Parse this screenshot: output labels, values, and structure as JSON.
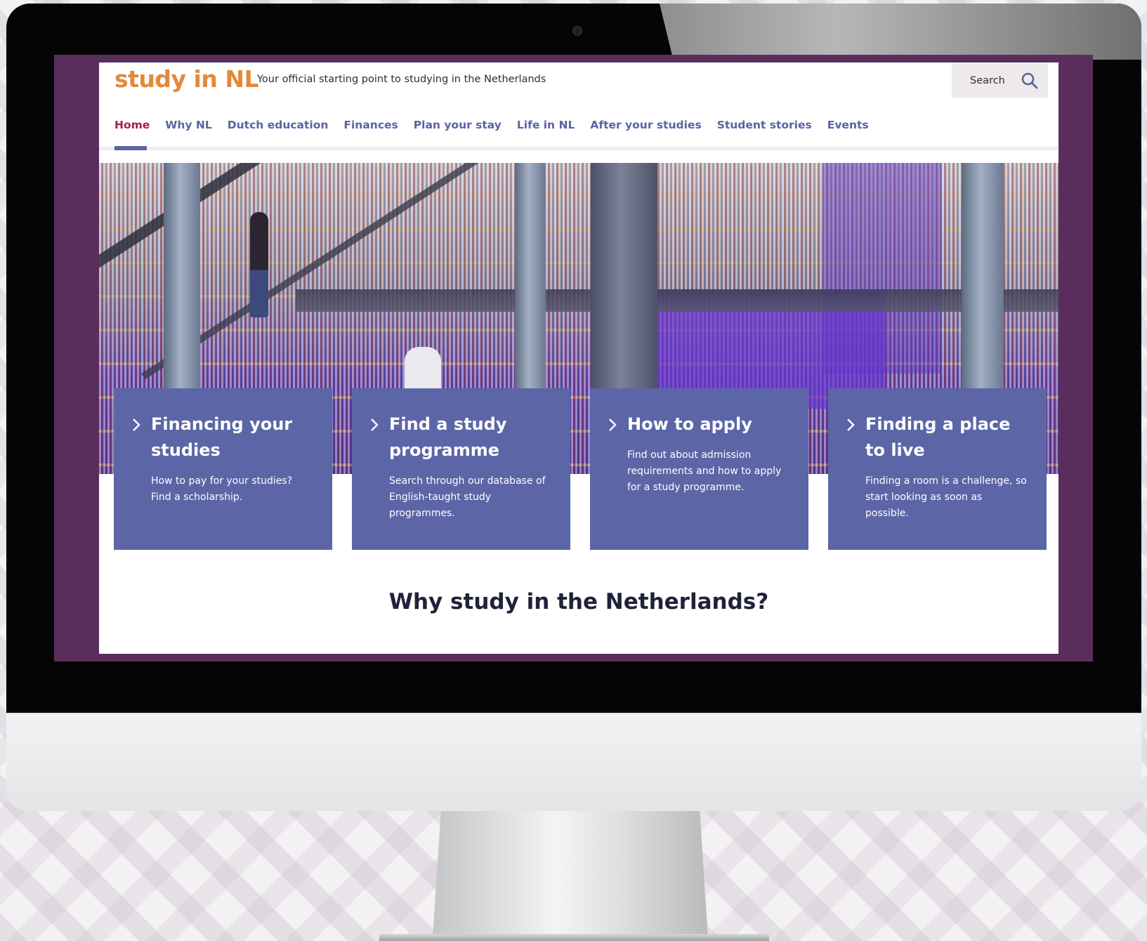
{
  "site": {
    "logo": "study in NL",
    "tagline": "Your official starting point to studying in the Netherlands"
  },
  "search": {
    "label": "Search",
    "icon": "search-icon"
  },
  "nav": {
    "items": [
      {
        "label": "Home",
        "active": true
      },
      {
        "label": "Why NL"
      },
      {
        "label": "Dutch education"
      },
      {
        "label": "Finances"
      },
      {
        "label": "Plan your stay"
      },
      {
        "label": "Life in NL"
      },
      {
        "label": "After your studies"
      },
      {
        "label": "Student stories"
      },
      {
        "label": "Events"
      }
    ]
  },
  "cards": [
    {
      "title": "Financing your studies",
      "text": "How to pay for your studies? Find a scholarship.",
      "icon": "chevron-right-icon"
    },
    {
      "title": "Find a study programme",
      "text": "Search through our database of English-taught study programmes.",
      "icon": "chevron-right-icon"
    },
    {
      "title": "How to apply",
      "text": "Find out about admission requirements and how to apply for a study programme.",
      "icon": "chevron-right-icon"
    },
    {
      "title": "Finding a place to live",
      "text": "Finding a room is a challenge, so start looking as soon as possible.",
      "icon": "chevron-right-icon"
    }
  ],
  "section": {
    "title": "Why study in the Netherlands?"
  },
  "colors": {
    "brand_orange": "#e2893a",
    "nav_blue": "#5a63a3",
    "nav_active": "#a61f4a",
    "card_blue": "#5c65a6",
    "frame_purple": "#5a2e5c"
  }
}
